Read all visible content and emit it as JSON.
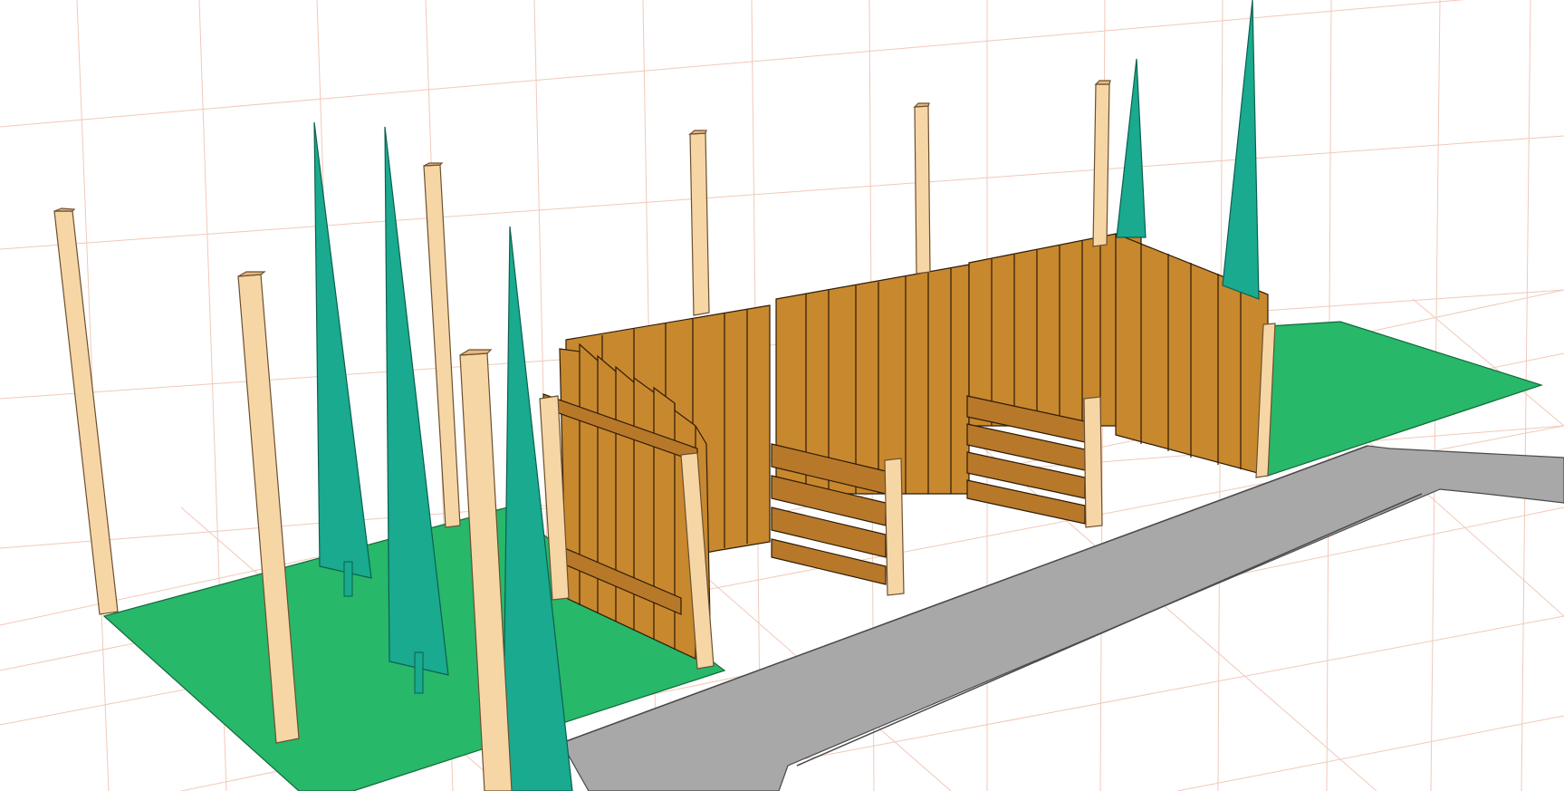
{
  "scene": {
    "background_color": "#ffffff",
    "grid_color": "#f0c9b8",
    "lawn_color": "#27b86a",
    "path_color": "#a8a8a8",
    "fence_color": "#c8882e",
    "post_color": "#f7d6a6",
    "tree_color": "#19aa8f",
    "objects": {
      "posts": "wooden-posts",
      "trees": "conical-trees",
      "fence": "plank-fence-enclosure",
      "gate": "plank-gate",
      "lawn": "grass-ground",
      "path": "stone-paving-path"
    }
  }
}
